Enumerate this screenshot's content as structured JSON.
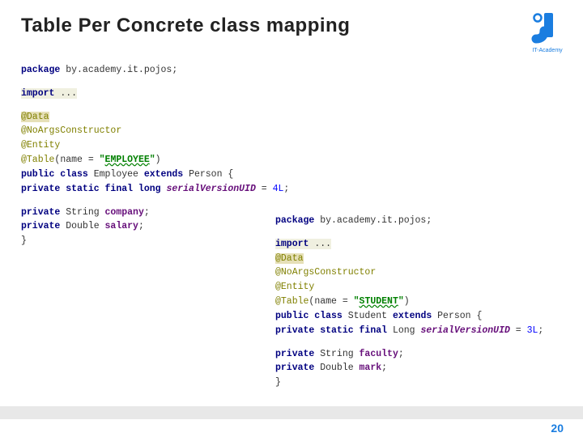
{
  "title": "Table Per Concrete class mapping",
  "logo": {
    "text": "IT-Academy"
  },
  "code1": {
    "l1a": "package",
    "l1b": " by.academy.it.pojos;",
    "l2a": "import ",
    "l2b": "...",
    "l3": "@Data",
    "l4": "@NoArgsConstructor",
    "l5": "@Entity",
    "l6a": "@Table",
    "l6b": "(name = ",
    "l6c": "\"",
    "l6d": "EMPLOYEE",
    "l6e": "\"",
    "l6f": ")",
    "l7a": "public class ",
    "l7b": "Employee ",
    "l7c": "extends ",
    "l7d": "Person {",
    "l8a": "    ",
    "l8b": "private static final long ",
    "l8c": "serialVersionUID ",
    "l8d": "= ",
    "l8e": "4L",
    "l8f": ";",
    "l9a": "    ",
    "l9b": "private ",
    "l9c": "String ",
    "l9d": "company",
    "l9e": ";",
    "l10a": "    ",
    "l10b": "private ",
    "l10c": "Double ",
    "l10d": "salary",
    "l10e": ";",
    "l11": "}"
  },
  "code2": {
    "l1a": "package",
    "l1b": " by.academy.it.pojos;",
    "l2a": "import ",
    "l2b": "...",
    "l3": "@Data",
    "l4": "@NoArgsConstructor",
    "l5": "@Entity",
    "l6a": "@Table",
    "l6b": "(name = ",
    "l6c": "\"",
    "l6d": "STUDENT",
    "l6e": "\"",
    "l6f": ")",
    "l7a": "public class ",
    "l7b": "Student ",
    "l7c": "extends ",
    "l7d": "Person {",
    "l8a": "    ",
    "l8b": "private static final ",
    "l8c": "Long ",
    "l8d": "serialVersionUID ",
    "l8e": "= ",
    "l8f": "3L",
    "l8g": ";",
    "l9a": "    ",
    "l9b": "private ",
    "l9c": "String ",
    "l9d": "faculty",
    "l9e": ";",
    "l10a": "    ",
    "l10b": "private ",
    "l10c": "Double ",
    "l10d": "mark",
    "l10e": ";",
    "l11": "}"
  },
  "page_number": "20"
}
